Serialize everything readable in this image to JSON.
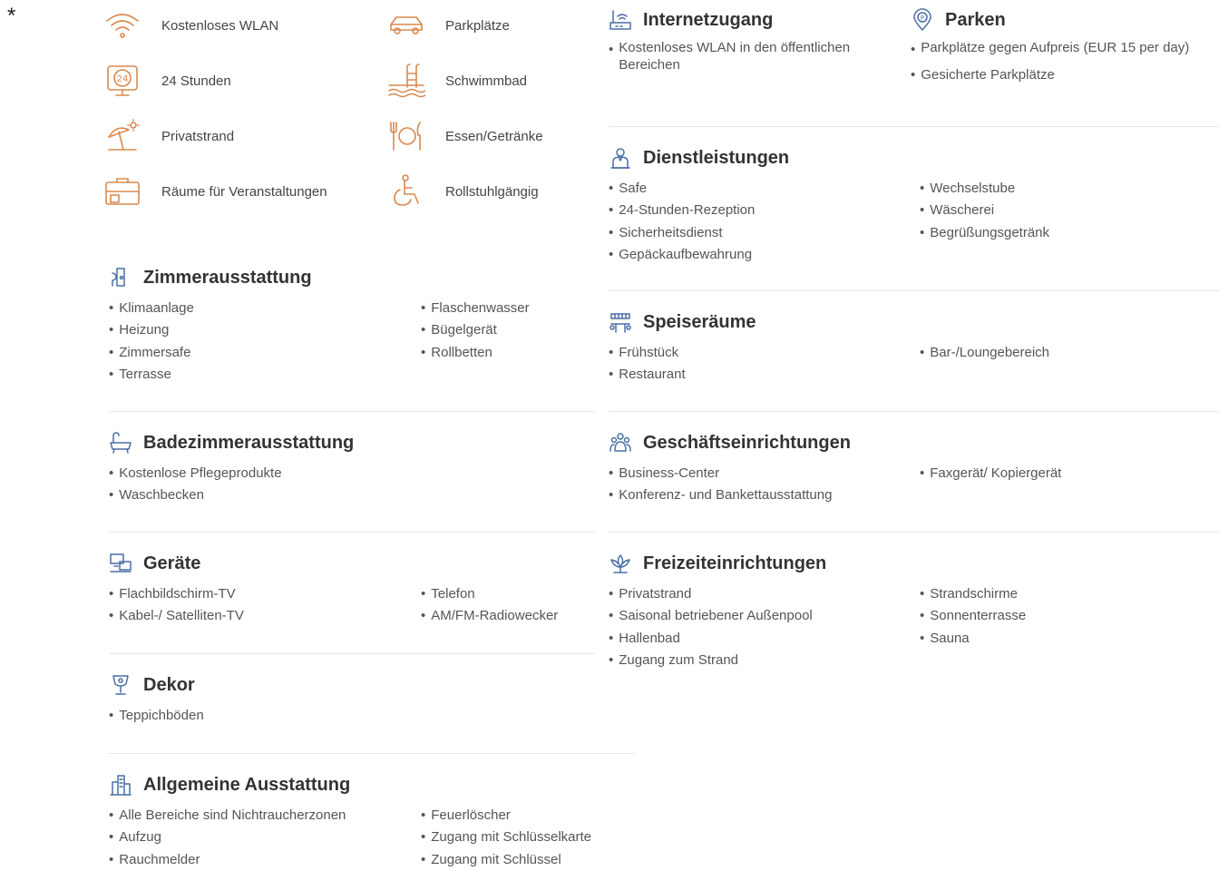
{
  "highlights": [
    {
      "label": "Kostenloses WLAN",
      "icon": "wifi-icon"
    },
    {
      "label": "Parkplätze",
      "icon": "car-icon"
    },
    {
      "label": "24 Stunden",
      "icon": "clock-24-icon"
    },
    {
      "label": "Schwimmbad",
      "icon": "pool-icon"
    },
    {
      "label": "Privatstrand",
      "icon": "beach-umbrella-icon"
    },
    {
      "label": "Essen/Getränke",
      "icon": "dining-icon"
    },
    {
      "label": "Räume für Veranstaltungen",
      "icon": "briefcase-icon"
    },
    {
      "label": "Rollstuhlgängig",
      "icon": "wheelchair-icon"
    }
  ],
  "sections": {
    "zimmer": {
      "title": "Zimmerausstattung",
      "col1": [
        "Klimaanlage",
        "Heizung",
        "Zimmersafe",
        "Terrasse"
      ],
      "col2": [
        "Flaschenwasser",
        "Bügelgerät",
        "Rollbetten"
      ]
    },
    "bad": {
      "title": "Badezimmerausstattung",
      "col1": [
        "Kostenlose Pflegeprodukte",
        "Waschbecken"
      ]
    },
    "geraete": {
      "title": "Geräte",
      "col1": [
        "Flachbildschirm-TV",
        "Kabel-/ Satelliten-TV"
      ],
      "col2": [
        "Telefon",
        "AM/FM-Radiowecker"
      ]
    },
    "dekor": {
      "title": "Dekor",
      "col1": [
        "Teppichböden"
      ]
    },
    "allgemein": {
      "title": "Allgemeine Ausstattung",
      "col1": [
        "Alle Bereiche sind Nichtraucherzonen",
        "Aufzug",
        "Rauchmelder"
      ],
      "col2": [
        "Feuerlöscher",
        "Zugang mit Schlüsselkarte",
        "Zugang mit Schlüssel"
      ]
    },
    "internet": {
      "title": "Internetzugang",
      "col1": [
        "Kostenloses WLAN in den öffentlichen Bereichen"
      ]
    },
    "parken": {
      "title": "Parken",
      "col1": [
        "Parkplätze gegen Aufpreis (EUR 15 per day)",
        "Gesicherte Parkplätze"
      ]
    },
    "dienst": {
      "title": "Dienstleistungen",
      "col1": [
        "Safe",
        "24-Stunden-Rezeption",
        "Sicherheitsdienst",
        "Gepäckaufbewahrung"
      ],
      "col2": [
        "Wechselstube",
        "Wäscherei",
        "Begrüßungsgetränk"
      ]
    },
    "speise": {
      "title": "Speiseräume",
      "col1": [
        "Frühstück",
        "Restaurant"
      ],
      "col2": [
        "Bar-/Loungebereich"
      ]
    },
    "geschaeft": {
      "title": "Geschäftseinrichtungen",
      "col1": [
        "Business-Center",
        "Konferenz- und Bankettausstattung"
      ],
      "col2": [
        "Faxgerät/ Kopiergerät"
      ]
    },
    "freizeit": {
      "title": "Freizeiteinrichtungen",
      "col1": [
        "Privatstrand",
        "Saisonal betriebener Außenpool",
        "Hallenbad",
        "Zugang zum Strand"
      ],
      "col2": [
        "Strandschirme",
        "Sonnenterrasse",
        "Sauna"
      ]
    }
  },
  "colors": {
    "accent": "#d88a4e",
    "section_icon": "#4a6fa5",
    "text": "#555555",
    "heading": "#333333",
    "divider": "#e8e8e8"
  }
}
